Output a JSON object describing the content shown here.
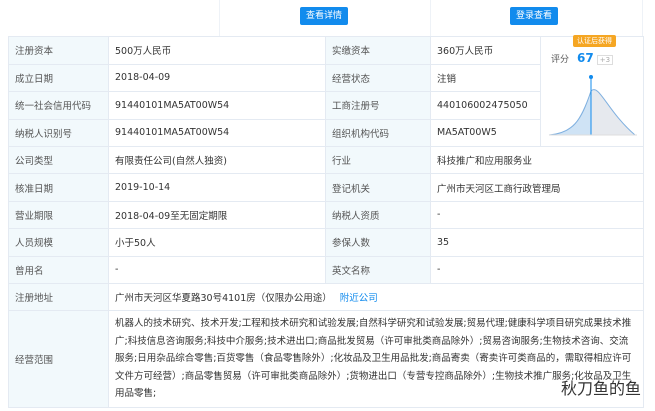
{
  "buttons": {
    "view_details": "查看详情",
    "login_view": "登录查看"
  },
  "rows": [
    {
      "l1": "注册资本",
      "v1": "500万人民币",
      "l2": "实缴资本",
      "v2": "360万人民币"
    },
    {
      "l1": "成立日期",
      "v1": "2018-04-09",
      "l2": "经营状态",
      "v2": "注销"
    },
    {
      "l1": "统一社会信用代码",
      "v1": "91440101MA5AT00W54",
      "l2": "工商注册号",
      "v2": "440106002475050"
    },
    {
      "l1": "纳税人识别号",
      "v1": "91440101MA5AT00W54",
      "l2": "组织机构代码",
      "v2": "MA5AT00W5"
    },
    {
      "l1": "公司类型",
      "v1": "有限责任公司(自然人独资)",
      "l2": "行业",
      "v2": "科技推广和应用服务业"
    },
    {
      "l1": "核准日期",
      "v1": "2019-10-14",
      "l2": "登记机关",
      "v2": "广州市天河区工商行政管理局"
    },
    {
      "l1": "营业期限",
      "v1": "2018-04-09至无固定期限",
      "l2": "纳税人资质",
      "v2": "-"
    },
    {
      "l1": "人员规模",
      "v1": "小于50人",
      "l2": "参保人数",
      "v2": "35"
    },
    {
      "l1": "曾用名",
      "v1": "-",
      "l2": "英文名称",
      "v2": "-"
    }
  ],
  "address": {
    "label": "注册地址",
    "value": "广州市天河区华夏路30号4101房（仅限办公用途）",
    "link": "附近公司"
  },
  "scope": {
    "label": "经营范围",
    "value": "机器人的技术研究、技术开发;工程和技术研究和试验发展;自然科学研究和试验发展;贸易代理;健康科学项目研究成果技术推广;科技信息咨询服务;科技中介服务;技术进出口;商品批发贸易（许可审批类商品除外）;贸易咨询服务;生物技术咨询、交流服务;日用杂品综合零售;百货零售（食品零售除外）;化妆品及卫生用品批发;商品寄卖（寄卖许可类商品的，需取得相应许可文件方可经营）;商品零售贸易（许可审批类商品除外）;货物进出口（专营专控商品除外）;生物技术推广服务;化妆品及卫生用品零售;"
  },
  "score": {
    "badge": "认证后获得",
    "label": "评分",
    "value": "67",
    "delta": "+3"
  },
  "watermark": "秋刀鱼的鱼"
}
